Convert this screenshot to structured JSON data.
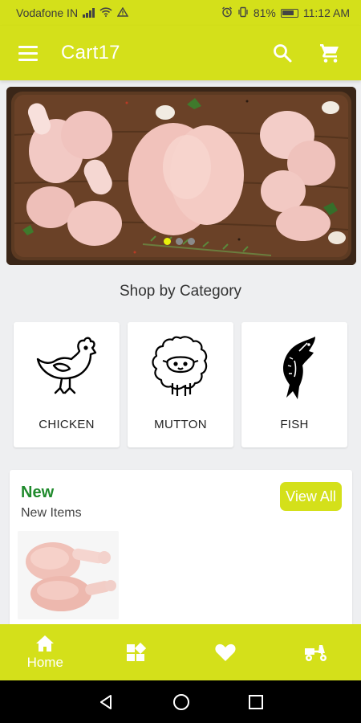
{
  "status_bar": {
    "carrier": "Vodafone IN",
    "battery": "81%",
    "time": "11:12 AM"
  },
  "app_bar": {
    "title": "Cart17",
    "menu_icon": "hamburger-menu-icon",
    "search_icon": "search-icon",
    "cart_icon": "shopping-cart-icon"
  },
  "banner": {
    "slides": 3,
    "active_slide": 1
  },
  "categories": {
    "title": "Shop by Category",
    "items": [
      {
        "label": "CHICKEN",
        "icon": "chicken-icon"
      },
      {
        "label": "MUTTON",
        "icon": "sheep-icon"
      },
      {
        "label": "FISH",
        "icon": "fish-icon"
      }
    ]
  },
  "new_section": {
    "title": "New",
    "subtitle": "New Items",
    "view_all": "View All"
  },
  "bottom_nav": {
    "items": [
      {
        "label": "Home",
        "icon": "home-icon"
      },
      {
        "label": "",
        "icon": "categories-icon"
      },
      {
        "label": "",
        "icon": "heart-icon"
      },
      {
        "label": "",
        "icon": "delivery-scooter-icon"
      }
    ]
  },
  "colors": {
    "accent": "#d4e01a",
    "new_title": "#1f8a2c",
    "background": "#eeeff1"
  }
}
